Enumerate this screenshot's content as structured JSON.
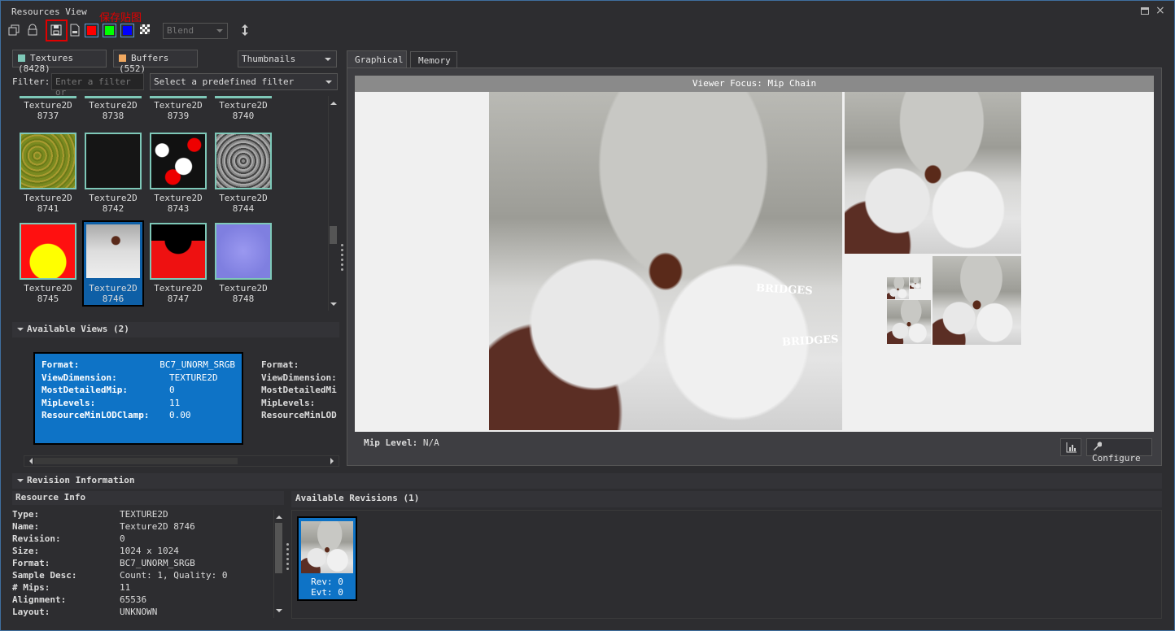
{
  "window": {
    "title": "Resources View"
  },
  "toolbar": {
    "annotation_label": "保存贴图",
    "blend_value": "Blend",
    "icons": [
      "copy-icon",
      "lock-icon",
      "save-texture-icon",
      "export-icon",
      "red-channel-icon",
      "green-channel-icon",
      "blue-channel-icon",
      "alpha-channel-icon",
      "resize-vertical-icon"
    ],
    "channel_colors": {
      "red": "#ff0000",
      "green": "#00ff00",
      "blue": "#0000ff"
    }
  },
  "filters": {
    "textures_label": "Textures (8428)",
    "buffers_label": "Buffers (552)",
    "view_mode": "Thumbnails",
    "filter_label": "Filter:",
    "filter_placeholder": "Enter a filter or",
    "predefined_filter": "Select a predefined filter",
    "textures_color": "#7ec8b8",
    "buffers_color": "#f0a860"
  },
  "textures": [
    {
      "type": "Texture2D",
      "id": "8737"
    },
    {
      "type": "Texture2D",
      "id": "8738"
    },
    {
      "type": "Texture2D",
      "id": "8739"
    },
    {
      "type": "Texture2D",
      "id": "8740"
    },
    {
      "type": "Texture2D",
      "id": "8741"
    },
    {
      "type": "Texture2D",
      "id": "8742"
    },
    {
      "type": "Texture2D",
      "id": "8743"
    },
    {
      "type": "Texture2D",
      "id": "8744"
    },
    {
      "type": "Texture2D",
      "id": "8745"
    },
    {
      "type": "Texture2D",
      "id": "8746",
      "selected": true
    },
    {
      "type": "Texture2D",
      "id": "8747"
    },
    {
      "type": "Texture2D",
      "id": "8748"
    }
  ],
  "available_views": {
    "header": "Available Views (2)",
    "view1": [
      {
        "k": "Format:",
        "v": "BC7_UNORM_SRGB"
      },
      {
        "k": "ViewDimension:",
        "v": "TEXTURE2D"
      },
      {
        "k": "MostDetailedMip:",
        "v": "0"
      },
      {
        "k": "MipLevels:",
        "v": "11"
      },
      {
        "k": "ResourceMinLODClamp:",
        "v": "0.00"
      }
    ],
    "view2": [
      "Format:",
      "ViewDimension:",
      "MostDetailedMi",
      "MipLevels:",
      "ResourceMinLOD"
    ]
  },
  "tabs": {
    "graphical": "Graphical",
    "memory": "Memory"
  },
  "viewer": {
    "focus_label": "Viewer Focus: Mip Chain",
    "mip_level_label": "Mip Level:",
    "mip_level_value": "N/A",
    "configure_label": "Configure",
    "bridges_text": "BRIDGES"
  },
  "revision_information": {
    "header": "Revision Information",
    "resource_info_header": "Resource Info",
    "rows": [
      {
        "k": "Type:",
        "v": "TEXTURE2D"
      },
      {
        "k": "Name:",
        "v": "Texture2D 8746"
      },
      {
        "k": "Revision:",
        "v": "0"
      },
      {
        "k": "Size:",
        "v": "1024 x 1024"
      },
      {
        "k": "Format:",
        "v": "BC7_UNORM_SRGB"
      },
      {
        "k": "Sample Desc:",
        "v": "Count: 1, Quality: 0"
      },
      {
        "k": "# Mips:",
        "v": "11"
      },
      {
        "k": "Alignment:",
        "v": "65536"
      },
      {
        "k": "Layout:",
        "v": "UNKNOWN"
      }
    ]
  },
  "available_revisions": {
    "header": "Available Revisions (1)",
    "cards": [
      {
        "rev": "Rev: 0",
        "evt": "Evt: 0"
      }
    ]
  }
}
